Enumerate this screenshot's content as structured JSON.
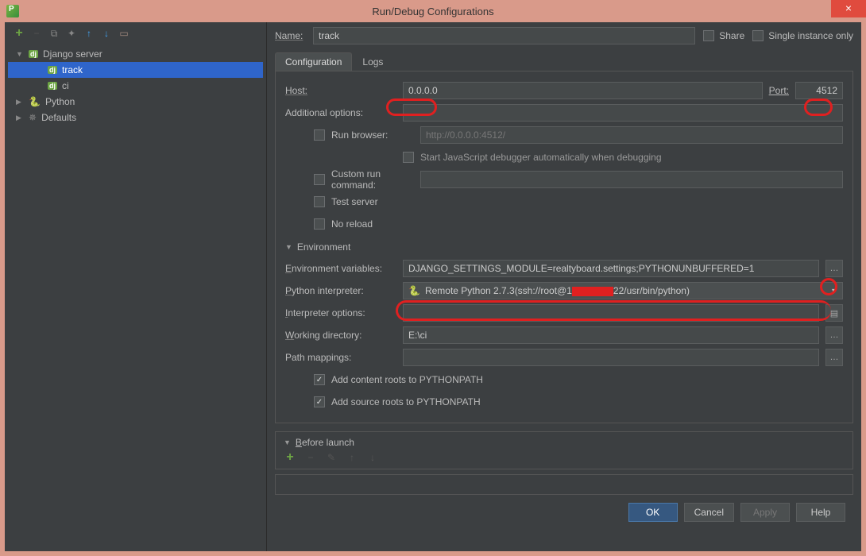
{
  "window": {
    "title": "Run/Debug Configurations"
  },
  "nameRow": {
    "label": "Name:",
    "value": "track",
    "share": "Share",
    "single": "Single instance only"
  },
  "tree": {
    "django": "Django server",
    "track": "track",
    "ci": "ci",
    "python": "Python",
    "defaults": "Defaults"
  },
  "tabs": {
    "config": "Configuration",
    "logs": "Logs"
  },
  "form": {
    "hostLabel": "Host:",
    "hostValue": "0.0.0.0",
    "portLabel": "Port:",
    "portValue": "4512",
    "addOpts": "Additional options:",
    "runBrowser": "Run browser:",
    "runBrowserPlaceholder": "http://0.0.0.0:4512/",
    "startJs": "Start JavaScript debugger automatically when debugging",
    "customCmd": "Custom run command:",
    "testServer": "Test server",
    "noReload": "No reload",
    "envHeader": "Environment",
    "envVarsLabel": "Environment variables:",
    "envVarsValue": "DJANGO_SETTINGS_MODULE=realtyboard.settings;PYTHONUNBUFFERED=1",
    "interpLabel": "Python interpreter:",
    "interpValuePrefix": "Remote Python 2.7.3(ssh://root@1",
    "interpValueSuffix": "22/usr/bin/python)",
    "interpOpts": "Interpreter options:",
    "workDirLabel": "Working directory:",
    "workDirValue": "E:\\ci",
    "pathMap": "Path mappings:",
    "addContent": "Add content roots to PYTHONPATH",
    "addSource": "Add source roots to PYTHONPATH"
  },
  "beforeLaunch": {
    "label": "Before launch"
  },
  "buttons": {
    "ok": "OK",
    "cancel": "Cancel",
    "apply": "Apply",
    "help": "Help"
  }
}
